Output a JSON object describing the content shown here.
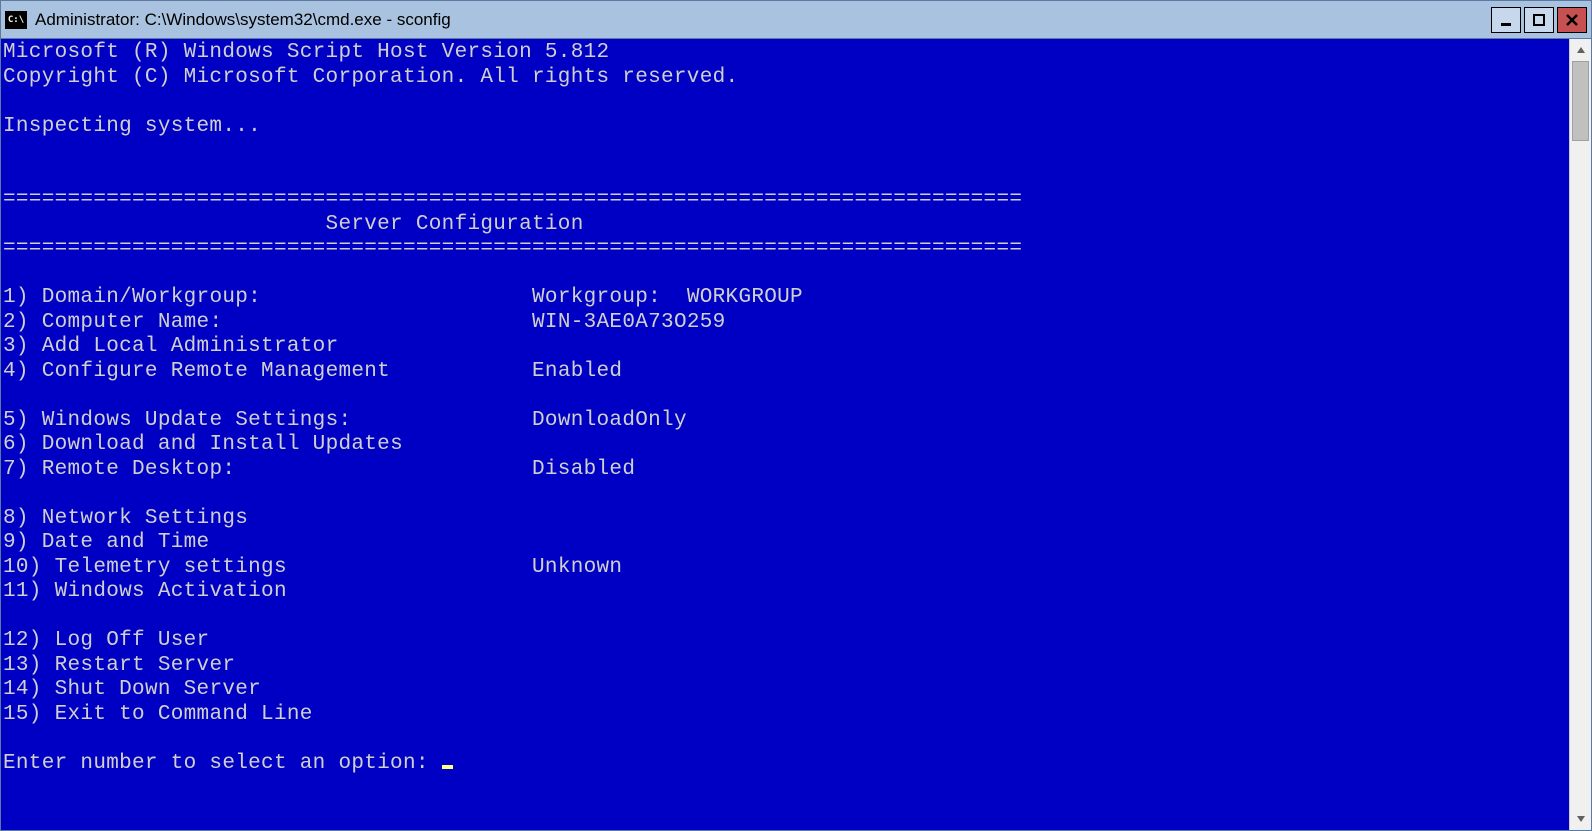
{
  "window": {
    "title": "Administrator: C:\\Windows\\system32\\cmd.exe - sconfig"
  },
  "console": {
    "header1": "Microsoft (R) Windows Script Host Version 5.812",
    "header2": "Copyright (C) Microsoft Corporation. All rights reserved.",
    "inspecting": "Inspecting system...",
    "divider": "===============================================================================",
    "title_line": "                         Server Configuration",
    "menu": {
      "item1_num": "1)",
      "item1_label": "Domain/Workgroup:",
      "item1_value": "Workgroup:  WORKGROUP",
      "item2_num": "2)",
      "item2_label": "Computer Name:",
      "item2_value": "WIN-3AE0A73O259",
      "item3_num": "3)",
      "item3_label": "Add Local Administrator",
      "item3_value": "",
      "item4_num": "4)",
      "item4_label": "Configure Remote Management",
      "item4_value": "Enabled",
      "item5_num": "5)",
      "item5_label": "Windows Update Settings:",
      "item5_value": "DownloadOnly",
      "item6_num": "6)",
      "item6_label": "Download and Install Updates",
      "item6_value": "",
      "item7_num": "7)",
      "item7_label": "Remote Desktop:",
      "item7_value": "Disabled",
      "item8_num": "8)",
      "item8_label": "Network Settings",
      "item8_value": "",
      "item9_num": "9)",
      "item9_label": "Date and Time",
      "item9_value": "",
      "item10_num": "10)",
      "item10_label": "Telemetry settings",
      "item10_value": "Unknown",
      "item11_num": "11)",
      "item11_label": "Windows Activation",
      "item11_value": "",
      "item12_num": "12)",
      "item12_label": "Log Off User",
      "item12_value": "",
      "item13_num": "13)",
      "item13_label": "Restart Server",
      "item13_value": "",
      "item14_num": "14)",
      "item14_label": "Shut Down Server",
      "item14_value": "",
      "item15_num": "15)",
      "item15_label": "Exit to Command Line",
      "item15_value": ""
    },
    "prompt": "Enter number to select an option: "
  }
}
